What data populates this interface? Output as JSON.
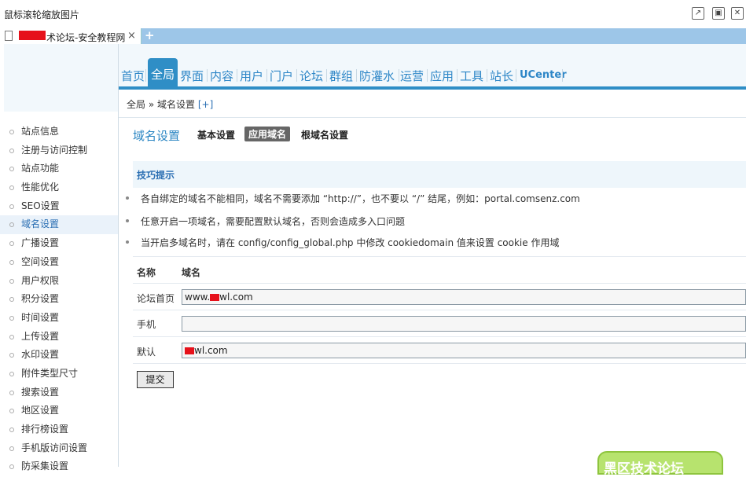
{
  "window": {
    "title": "鼠标滚轮缩放图片",
    "buttons": [
      "popout-icon",
      "restore-icon",
      "close-icon"
    ]
  },
  "tab": {
    "label": "术论坛-安全教程网",
    "close": "×",
    "new_tab": "+"
  },
  "sidebar": {
    "items": [
      {
        "label": "站点信息"
      },
      {
        "label": "注册与访问控制"
      },
      {
        "label": "站点功能"
      },
      {
        "label": "性能优化"
      },
      {
        "label": "SEO设置"
      },
      {
        "label": "域名设置",
        "active": true
      },
      {
        "label": "广播设置"
      },
      {
        "label": "空间设置"
      },
      {
        "label": "用户权限"
      },
      {
        "label": "积分设置"
      },
      {
        "label": "时间设置"
      },
      {
        "label": "上传设置"
      },
      {
        "label": "水印设置"
      },
      {
        "label": "附件类型尺寸"
      },
      {
        "label": "搜索设置"
      },
      {
        "label": "地区设置"
      },
      {
        "label": "排行榜设置"
      },
      {
        "label": "手机版访问设置"
      },
      {
        "label": "防采集设置"
      }
    ]
  },
  "nav": {
    "items": [
      {
        "label": "首页"
      },
      {
        "label": "全局",
        "active": true
      },
      {
        "label": "界面"
      },
      {
        "label": "内容"
      },
      {
        "label": "用户"
      },
      {
        "label": "门户"
      },
      {
        "label": "论坛"
      },
      {
        "label": "群组"
      },
      {
        "label": "防灌水"
      },
      {
        "label": "运营"
      },
      {
        "label": "应用"
      },
      {
        "label": "工具"
      },
      {
        "label": "站长"
      },
      {
        "label": "UCenter"
      }
    ]
  },
  "breadcrumb": {
    "root": "全局",
    "sep": "»",
    "current": "域名设置",
    "add": "[+]"
  },
  "page": {
    "title": "域名设置",
    "subtabs": [
      {
        "label": "基本设置"
      },
      {
        "label": "应用域名",
        "active": true
      },
      {
        "label": "根域名设置"
      }
    ],
    "tips_title": "技巧提示",
    "tips": [
      "各自绑定的域名不能相同，域名不需要添加 “http://”，也不要以 “/” 结尾，例如：portal.comsenz.com",
      "任意开启一项域名，需要配置默认域名，否则会造成多入口问题",
      "当开启多域名时，请在 config/config_global.php 中修改 cookiedomain 值来设置 cookie 作用域"
    ],
    "col_name": "名称",
    "col_domain": "域名",
    "rows": [
      {
        "label": "论坛首页",
        "prefix": "www.",
        "suffix": "wl.com"
      },
      {
        "label": "手机",
        "prefix": "",
        "suffix": ""
      },
      {
        "label": "默认",
        "prefix": "",
        "suffix": "wl.com"
      }
    ],
    "submit": "提交"
  },
  "watermark": {
    "text": "黑区技术论坛"
  },
  "colors": {
    "accent": "#2f8ec6",
    "link": "#2b86c3",
    "redact": "#e6111b"
  }
}
